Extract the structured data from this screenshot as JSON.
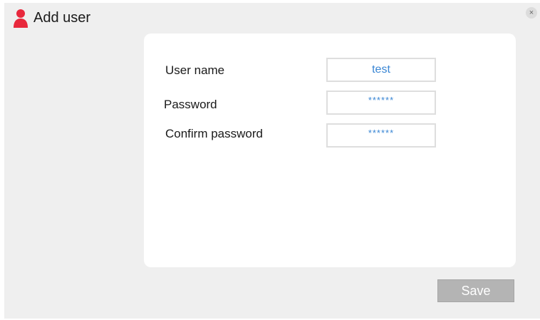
{
  "dialog": {
    "title": "Add user",
    "close_label": "×",
    "icon": "user-icon",
    "accent_color": "#e8283c"
  },
  "form": {
    "username": {
      "label": "User name",
      "value": "test"
    },
    "password": {
      "label": "Password",
      "value": "******"
    },
    "confirm_password": {
      "label": "Confirm password",
      "value": "******"
    }
  },
  "actions": {
    "save_label": "Save"
  }
}
